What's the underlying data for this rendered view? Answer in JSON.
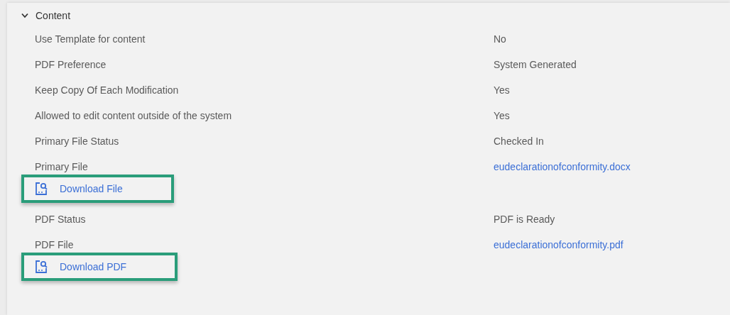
{
  "section": {
    "title": "Content",
    "expanded": true
  },
  "rows": [
    {
      "label": "Use Template for content",
      "value": "No",
      "kind": "text"
    },
    {
      "label": "PDF Preference",
      "value": "System Generated",
      "kind": "text"
    },
    {
      "label": "Keep Copy Of Each Modification",
      "value": "Yes",
      "kind": "text"
    },
    {
      "label": "Allowed to edit content outside of the system",
      "value": "Yes",
      "kind": "text"
    },
    {
      "label": "Primary File Status",
      "value": "Checked In",
      "kind": "text"
    },
    {
      "label": "Primary File",
      "value": "eudeclarationofconformity.docx",
      "kind": "link",
      "action": {
        "label": "Download File",
        "highlighted": true
      }
    },
    {
      "label": "PDF Status",
      "value": "PDF is Ready",
      "kind": "text"
    },
    {
      "label": "PDF File",
      "value": "eudeclarationofconformity.pdf",
      "kind": "link",
      "action": {
        "label": "Download PDF",
        "highlighted": true
      }
    }
  ]
}
